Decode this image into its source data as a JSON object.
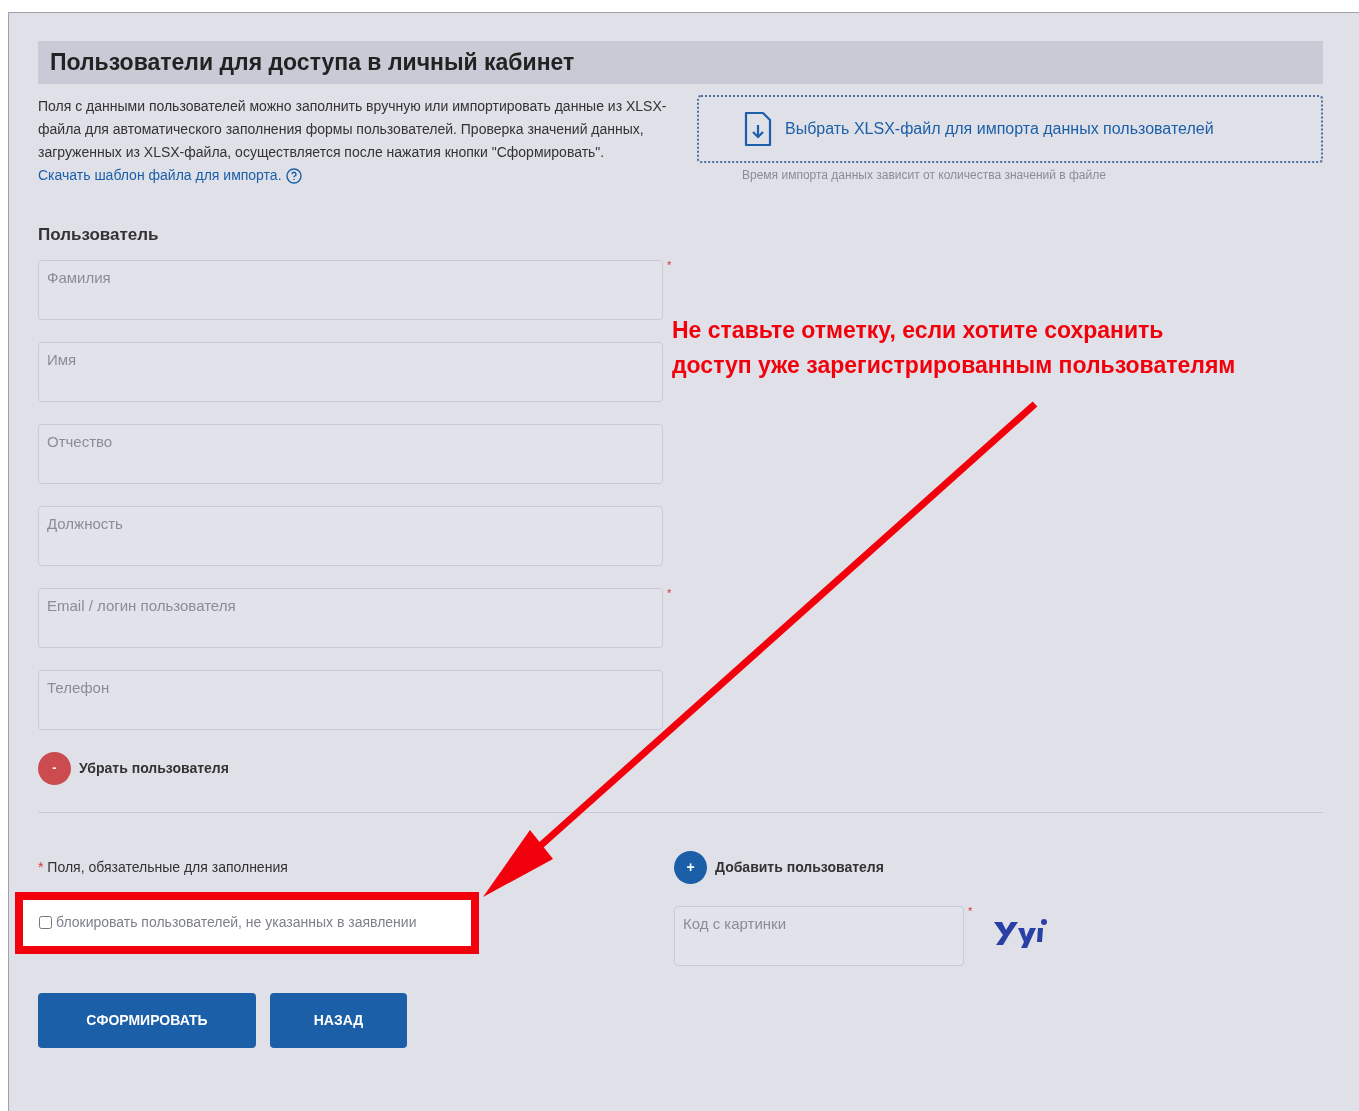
{
  "title": "Пользователи для доступа в личный кабинет",
  "description": "Поля с данными пользователей можно заполнить вручную или импортировать данные из XLSX-файла для автоматического заполнения формы пользователей. Проверка значений данных, загруженных из XLSX-файла, осуществляется после нажатия кнопки \"Сформировать\".",
  "template_link": "Скачать шаблон файла для импорта.",
  "import": {
    "label": "Выбрать XLSX-файл для импорта данных пользователей",
    "hint": "Время импорта данных зависит от количества значений в файле"
  },
  "user_section": "Пользователь",
  "fields": [
    {
      "placeholder": "Фамилия",
      "required": true
    },
    {
      "placeholder": "Имя",
      "required": false
    },
    {
      "placeholder": "Отчество",
      "required": false
    },
    {
      "placeholder": "Должность",
      "required": false
    },
    {
      "placeholder": "Email / логин пользователя",
      "required": true
    },
    {
      "placeholder": "Телефон",
      "required": false
    }
  ],
  "remove_user": {
    "icon": "-",
    "label": "Убрать пользователя"
  },
  "required_note": {
    "mark": "*",
    "text": "Поля, обязательные для заполнения"
  },
  "block_checkbox": {
    "label": "блокировать пользователей, не указанных в заявлении",
    "checked": false
  },
  "add_user": {
    "icon": "+",
    "label": "Добавить пользователя"
  },
  "captcha": {
    "placeholder": "Код с картинки",
    "required": true
  },
  "buttons": [
    "СФОРМИРОВАТЬ",
    "НАЗАД"
  ],
  "annotation": {
    "text": "Не ставьте отметку, если хотите сохранить\nдоступ уже зарегистрированным пользователям"
  }
}
